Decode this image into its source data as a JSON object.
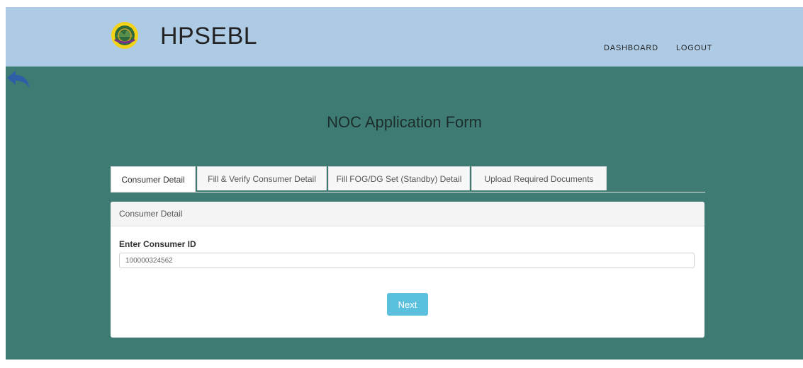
{
  "header": {
    "brand": "HPSEBL",
    "nav": {
      "dashboard": "DASHBOARD",
      "logout": "LOGOUT"
    }
  },
  "page": {
    "title": "NOC Application Form"
  },
  "tabs": [
    {
      "label": "Consumer Detail",
      "active": true
    },
    {
      "label": "Fill & Verify Consumer Detail",
      "active": false
    },
    {
      "label": "Fill FOG/DG Set (Standby) Detail",
      "active": false
    },
    {
      "label": "Upload Required Documents",
      "active": false
    }
  ],
  "panel": {
    "heading": "Consumer Detail",
    "field_label": "Enter Consumer ID",
    "consumer_id_value": "100000324562",
    "next_label": "Next"
  },
  "colors": {
    "header_bg": "#aecbe6",
    "page_bg": "#3e7b73",
    "button_bg": "#5bc0de",
    "back_arrow": "#2d5fa6"
  },
  "icons": {
    "logo": "hpsebl-emblem",
    "back": "back-arrow-icon"
  }
}
